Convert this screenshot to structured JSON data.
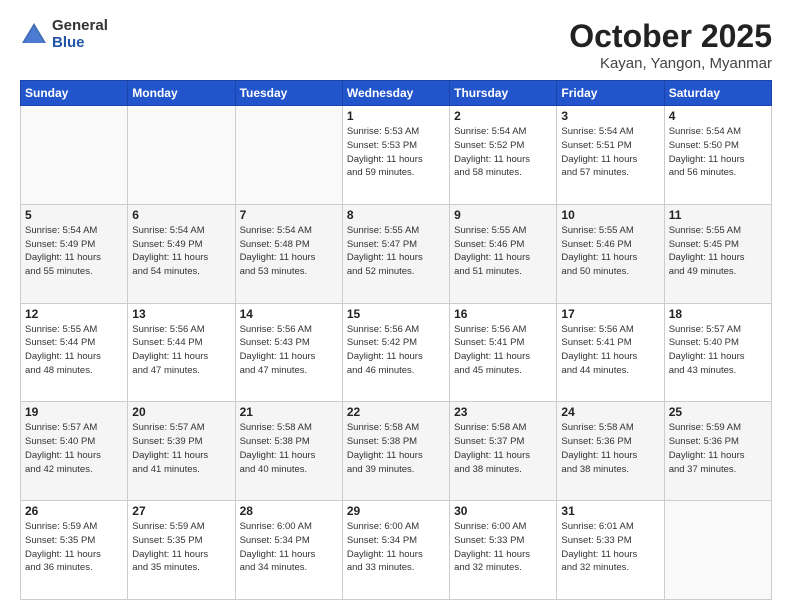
{
  "logo": {
    "general": "General",
    "blue": "Blue"
  },
  "title": "October 2025",
  "subtitle": "Kayan, Yangon, Myanmar",
  "header_days": [
    "Sunday",
    "Monday",
    "Tuesday",
    "Wednesday",
    "Thursday",
    "Friday",
    "Saturday"
  ],
  "weeks": [
    [
      {
        "day": "",
        "info": ""
      },
      {
        "day": "",
        "info": ""
      },
      {
        "day": "",
        "info": ""
      },
      {
        "day": "1",
        "info": "Sunrise: 5:53 AM\nSunset: 5:53 PM\nDaylight: 11 hours\nand 59 minutes."
      },
      {
        "day": "2",
        "info": "Sunrise: 5:54 AM\nSunset: 5:52 PM\nDaylight: 11 hours\nand 58 minutes."
      },
      {
        "day": "3",
        "info": "Sunrise: 5:54 AM\nSunset: 5:51 PM\nDaylight: 11 hours\nand 57 minutes."
      },
      {
        "day": "4",
        "info": "Sunrise: 5:54 AM\nSunset: 5:50 PM\nDaylight: 11 hours\nand 56 minutes."
      }
    ],
    [
      {
        "day": "5",
        "info": "Sunrise: 5:54 AM\nSunset: 5:49 PM\nDaylight: 11 hours\nand 55 minutes."
      },
      {
        "day": "6",
        "info": "Sunrise: 5:54 AM\nSunset: 5:49 PM\nDaylight: 11 hours\nand 54 minutes."
      },
      {
        "day": "7",
        "info": "Sunrise: 5:54 AM\nSunset: 5:48 PM\nDaylight: 11 hours\nand 53 minutes."
      },
      {
        "day": "8",
        "info": "Sunrise: 5:55 AM\nSunset: 5:47 PM\nDaylight: 11 hours\nand 52 minutes."
      },
      {
        "day": "9",
        "info": "Sunrise: 5:55 AM\nSunset: 5:46 PM\nDaylight: 11 hours\nand 51 minutes."
      },
      {
        "day": "10",
        "info": "Sunrise: 5:55 AM\nSunset: 5:46 PM\nDaylight: 11 hours\nand 50 minutes."
      },
      {
        "day": "11",
        "info": "Sunrise: 5:55 AM\nSunset: 5:45 PM\nDaylight: 11 hours\nand 49 minutes."
      }
    ],
    [
      {
        "day": "12",
        "info": "Sunrise: 5:55 AM\nSunset: 5:44 PM\nDaylight: 11 hours\nand 48 minutes."
      },
      {
        "day": "13",
        "info": "Sunrise: 5:56 AM\nSunset: 5:44 PM\nDaylight: 11 hours\nand 47 minutes."
      },
      {
        "day": "14",
        "info": "Sunrise: 5:56 AM\nSunset: 5:43 PM\nDaylight: 11 hours\nand 47 minutes."
      },
      {
        "day": "15",
        "info": "Sunrise: 5:56 AM\nSunset: 5:42 PM\nDaylight: 11 hours\nand 46 minutes."
      },
      {
        "day": "16",
        "info": "Sunrise: 5:56 AM\nSunset: 5:41 PM\nDaylight: 11 hours\nand 45 minutes."
      },
      {
        "day": "17",
        "info": "Sunrise: 5:56 AM\nSunset: 5:41 PM\nDaylight: 11 hours\nand 44 minutes."
      },
      {
        "day": "18",
        "info": "Sunrise: 5:57 AM\nSunset: 5:40 PM\nDaylight: 11 hours\nand 43 minutes."
      }
    ],
    [
      {
        "day": "19",
        "info": "Sunrise: 5:57 AM\nSunset: 5:40 PM\nDaylight: 11 hours\nand 42 minutes."
      },
      {
        "day": "20",
        "info": "Sunrise: 5:57 AM\nSunset: 5:39 PM\nDaylight: 11 hours\nand 41 minutes."
      },
      {
        "day": "21",
        "info": "Sunrise: 5:58 AM\nSunset: 5:38 PM\nDaylight: 11 hours\nand 40 minutes."
      },
      {
        "day": "22",
        "info": "Sunrise: 5:58 AM\nSunset: 5:38 PM\nDaylight: 11 hours\nand 39 minutes."
      },
      {
        "day": "23",
        "info": "Sunrise: 5:58 AM\nSunset: 5:37 PM\nDaylight: 11 hours\nand 38 minutes."
      },
      {
        "day": "24",
        "info": "Sunrise: 5:58 AM\nSunset: 5:36 PM\nDaylight: 11 hours\nand 38 minutes."
      },
      {
        "day": "25",
        "info": "Sunrise: 5:59 AM\nSunset: 5:36 PM\nDaylight: 11 hours\nand 37 minutes."
      }
    ],
    [
      {
        "day": "26",
        "info": "Sunrise: 5:59 AM\nSunset: 5:35 PM\nDaylight: 11 hours\nand 36 minutes."
      },
      {
        "day": "27",
        "info": "Sunrise: 5:59 AM\nSunset: 5:35 PM\nDaylight: 11 hours\nand 35 minutes."
      },
      {
        "day": "28",
        "info": "Sunrise: 6:00 AM\nSunset: 5:34 PM\nDaylight: 11 hours\nand 34 minutes."
      },
      {
        "day": "29",
        "info": "Sunrise: 6:00 AM\nSunset: 5:34 PM\nDaylight: 11 hours\nand 33 minutes."
      },
      {
        "day": "30",
        "info": "Sunrise: 6:00 AM\nSunset: 5:33 PM\nDaylight: 11 hours\nand 32 minutes."
      },
      {
        "day": "31",
        "info": "Sunrise: 6:01 AM\nSunset: 5:33 PM\nDaylight: 11 hours\nand 32 minutes."
      },
      {
        "day": "",
        "info": ""
      }
    ]
  ]
}
